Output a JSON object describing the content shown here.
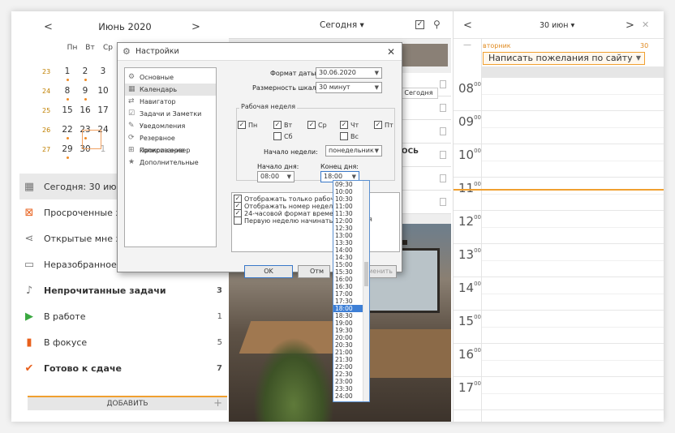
{
  "calendar": {
    "month_label": "Июнь 2020",
    "prev": "<",
    "next": ">",
    "dow": [
      "Пн",
      "Вт",
      "Ср"
    ],
    "weeks": [
      {
        "wn": "23",
        "days": [
          "1",
          "2",
          "3"
        ],
        "dots": [
          true,
          true,
          false
        ]
      },
      {
        "wn": "24",
        "days": [
          "8",
          "9",
          "10"
        ],
        "dots": [
          true,
          true,
          false
        ]
      },
      {
        "wn": "25",
        "days": [
          "15",
          "16",
          "17"
        ],
        "dots": [
          false,
          false,
          false
        ]
      },
      {
        "wn": "26",
        "days": [
          "22",
          "23",
          "24"
        ],
        "dots": [
          true,
          true,
          false
        ]
      },
      {
        "wn": "27",
        "days": [
          "29",
          "30",
          "1"
        ],
        "dots": [
          true,
          false,
          false
        ]
      }
    ]
  },
  "nav": {
    "items": [
      {
        "label": "Сегодня: 30 июн, вт",
        "icon": "calendar-icon",
        "count": ""
      },
      {
        "label": "Просроченные зада",
        "icon": "overdue-icon",
        "count": ""
      },
      {
        "label": "Открытые мне зада",
        "icon": "share-icon",
        "count": ""
      },
      {
        "label": "Неразобранное",
        "icon": "inbox-icon",
        "count": ""
      },
      {
        "label": "Непрочитанные задачи",
        "icon": "bell-icon",
        "count": "3"
      },
      {
        "label": "В работе",
        "icon": "play-icon",
        "count": "1"
      },
      {
        "label": "В фокусе",
        "icon": "bookmark-icon",
        "count": "5"
      },
      {
        "label": "Готово к сдаче",
        "icon": "check-icon",
        "count": "7"
      }
    ],
    "add_label": "ДОБАВИТЬ",
    "add_plus": "+"
  },
  "middle": {
    "title": "Сегодня ▾",
    "check": "✓",
    "badge": "Сегодня",
    "partial_text": "ЮСЬ"
  },
  "right": {
    "title": "30 июн ▾",
    "day_name": "вторник",
    "day_num": "30",
    "dash": "—",
    "task": "Написать пожелания по сайту",
    "hours": [
      "08",
      "09",
      "10",
      "11",
      "12",
      "13",
      "14",
      "15",
      "16",
      "17"
    ],
    "minutes": "00"
  },
  "dialog": {
    "title": "Настройки",
    "close": "✕",
    "nav": [
      {
        "label": "Основные",
        "icon": "general-icon"
      },
      {
        "label": "Календарь",
        "icon": "calendar-icon"
      },
      {
        "label": "Навигатор",
        "icon": "navigator-icon"
      },
      {
        "label": "Задачи и Заметки",
        "icon": "tasks-icon"
      },
      {
        "label": "Уведомления",
        "icon": "notify-icon"
      },
      {
        "label": "Резервное копирование",
        "icon": "backup-icon"
      },
      {
        "label": "Прокси-сервер",
        "icon": "proxy-icon"
      },
      {
        "label": "Дополнительные",
        "icon": "star-icon"
      }
    ],
    "date_format_label": "Формат даты:",
    "date_format_value": "30.06.2020",
    "scale_label": "Размерность шкалы:",
    "scale_value": "30 минут",
    "work_week_label": "Рабочая неделя",
    "days": [
      {
        "label": "Пн",
        "checked": true
      },
      {
        "label": "Вт",
        "checked": true
      },
      {
        "label": "Ср",
        "checked": true
      },
      {
        "label": "Чт",
        "checked": true
      },
      {
        "label": "Пт",
        "checked": true
      },
      {
        "label": "Сб",
        "checked": false
      },
      {
        "label": "Вс",
        "checked": false
      }
    ],
    "week_start_label": "Начало недели:",
    "week_start_value": "понедельник",
    "day_start_label": "Начало дня:",
    "day_start_value": "08:00",
    "day_end_label": "Конец дня:",
    "day_end_value": "18:00",
    "options": [
      "Отображать только рабочее",
      "Отображать номер недели",
      "24-часовой формат времени",
      "Первую неделю начинать с п"
    ],
    "options_tail": "я",
    "ok": "OK",
    "cancel": "Отм",
    "apply": "рименить"
  },
  "time_list": {
    "items": [
      "09:30",
      "10:00",
      "10:30",
      "11:00",
      "11:30",
      "12:00",
      "12:30",
      "13:00",
      "13:30",
      "14:00",
      "14:30",
      "15:00",
      "15:30",
      "16:00",
      "16:30",
      "17:00",
      "17:30",
      "18:00",
      "18:30",
      "19:00",
      "19:30",
      "20:00",
      "20:30",
      "21:00",
      "21:30",
      "22:00",
      "22:30",
      "23:00",
      "23:30",
      "24:00"
    ],
    "selected": "18:00"
  }
}
